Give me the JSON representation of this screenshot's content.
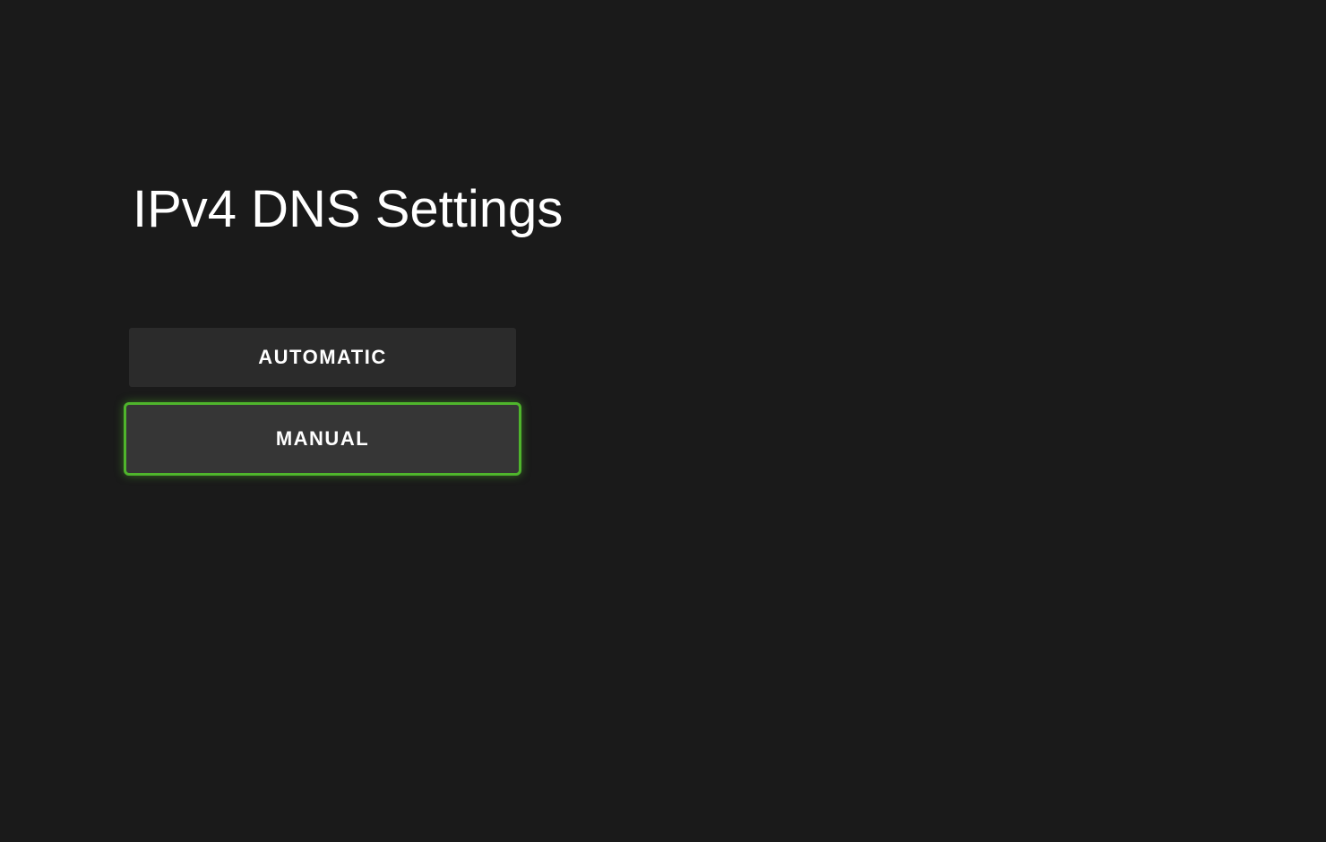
{
  "page": {
    "title": "IPv4 DNS Settings"
  },
  "options": {
    "automatic": {
      "label": "AUTOMATIC",
      "selected": false
    },
    "manual": {
      "label": "MANUAL",
      "selected": true
    }
  }
}
